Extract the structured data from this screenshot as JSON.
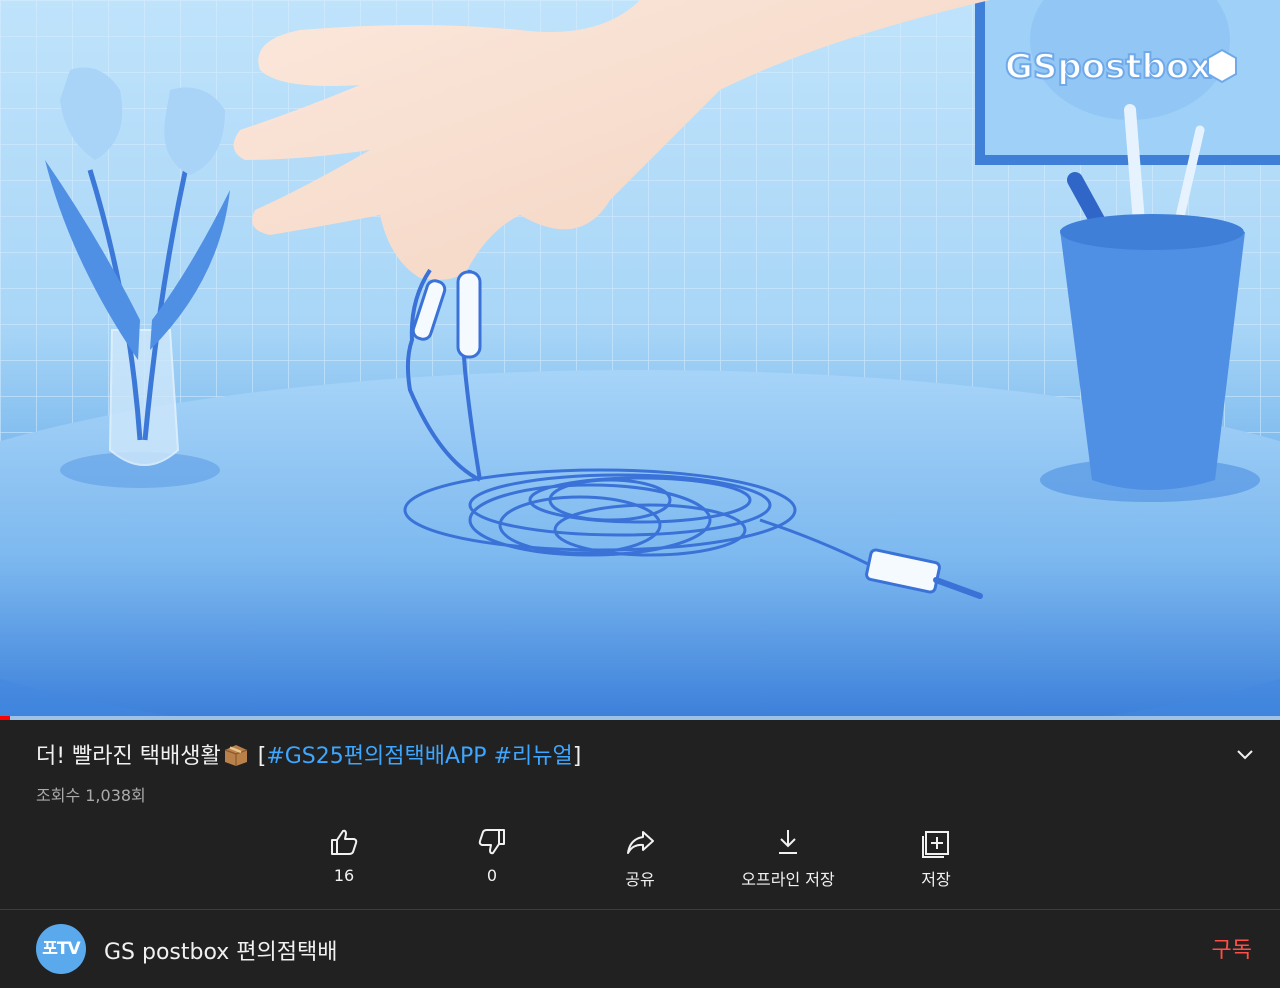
{
  "video": {
    "watermark": "GSpostbox",
    "progress_percent": 0.8
  },
  "title": {
    "main": "더! 빨라진 택배생활",
    "emoji_icon": "package-box-emoji",
    "bracket_open": "[",
    "tag1": "#GS25편의점택배APP",
    "space": " ",
    "tag2": "#리뉴얼",
    "bracket_close": "]"
  },
  "views": "조회수 1,038회",
  "actions": {
    "like": {
      "icon": "thumbs-up-icon",
      "label": "16"
    },
    "dislike": {
      "icon": "thumbs-down-icon",
      "label": "0"
    },
    "share": {
      "icon": "share-icon",
      "label": "공유"
    },
    "download": {
      "icon": "download-icon",
      "label": "오프라인 저장"
    },
    "save": {
      "icon": "save-playlist-icon",
      "label": "저장"
    }
  },
  "channel": {
    "avatar_text": "포TV",
    "name": "GS postbox 편의점택배",
    "subscribe_label": "구독"
  },
  "colors": {
    "background": "#212121",
    "hashtag": "#3ea6ff",
    "subscribe": "#ff4e45",
    "progress": "#ff0000"
  }
}
